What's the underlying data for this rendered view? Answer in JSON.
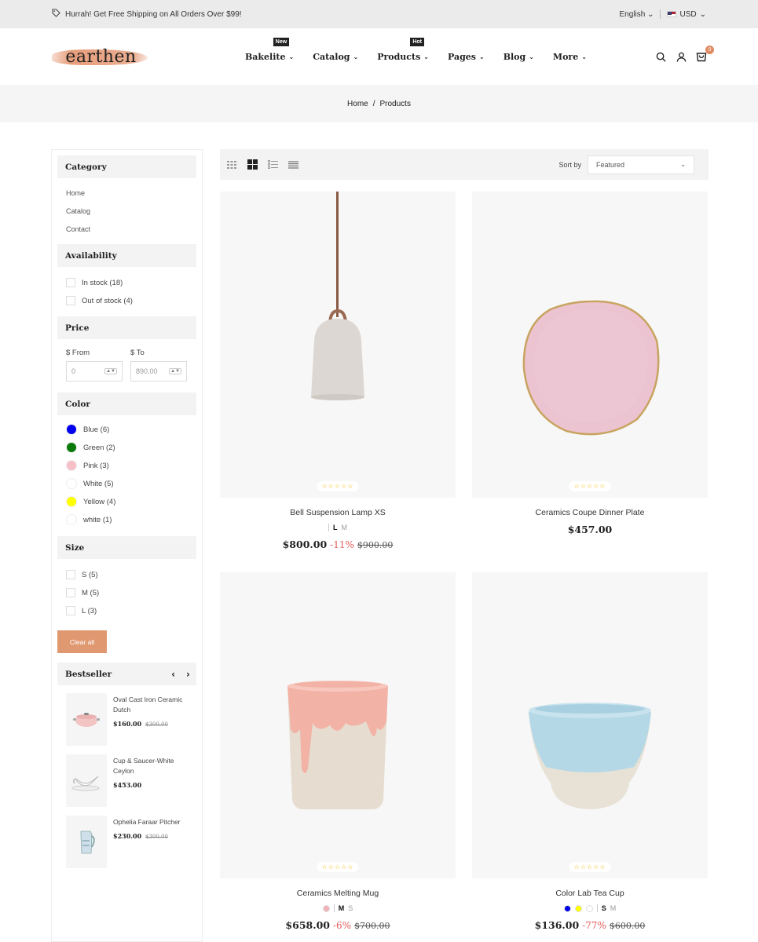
{
  "topbar": {
    "promo": "Hurrah! Get Free Shipping on All Orders Over $99!",
    "language": "English",
    "currency": "USD"
  },
  "header": {
    "logo": "earthen",
    "nav": [
      {
        "label": "Bakelite",
        "badge": "New"
      },
      {
        "label": "Catalog",
        "badge": ""
      },
      {
        "label": "Products",
        "badge": "Hot"
      },
      {
        "label": "Pages",
        "badge": ""
      },
      {
        "label": "Blog",
        "badge": ""
      },
      {
        "label": "More",
        "badge": ""
      }
    ],
    "cart_count": "0"
  },
  "breadcrumb": {
    "home": "Home",
    "separator": "/",
    "current": "Products"
  },
  "sidebar": {
    "category": {
      "title": "Category",
      "links": [
        "Home",
        "Catalog",
        "Contact"
      ]
    },
    "availability": {
      "title": "Availability",
      "options": [
        "In stock (18)",
        "Out of stock (4)"
      ]
    },
    "price": {
      "title": "Price",
      "from_label": "$ From",
      "to_label": "$ To",
      "from_placeholder": "0",
      "to_placeholder": "890.00"
    },
    "color": {
      "title": "Color",
      "options": [
        {
          "label": "Blue (6)",
          "swatch": "#0000ee"
        },
        {
          "label": "Green (2)",
          "swatch": "#0a7a0a"
        },
        {
          "label": "Pink (3)",
          "swatch": "#f7bfc8"
        },
        {
          "label": "White (5)",
          "swatch": "#ffffff"
        },
        {
          "label": "Yellow (4)",
          "swatch": "#ffff00"
        },
        {
          "label": "white (1)",
          "swatch": "#ffffff"
        }
      ]
    },
    "size": {
      "title": "Size",
      "options": [
        "S (5)",
        "M (5)",
        "L (3)"
      ]
    },
    "clear_label": "Clear all",
    "bestseller": {
      "title": "Bestseller",
      "items": [
        {
          "name": "Oval Cast Iron Ceramic Dutch",
          "price": "$160.00",
          "old_price": "$300.00"
        },
        {
          "name": "Cup & Saucer-White Ceylon",
          "price": "$453.00",
          "old_price": ""
        },
        {
          "name": "Ophelia Faraar Pitcher",
          "price": "$230.00",
          "old_price": "$300.00"
        }
      ]
    }
  },
  "toolbar": {
    "sort_label": "Sort by",
    "sort_value": "Featured"
  },
  "products": [
    {
      "title": "Bell Suspension Lamp XS",
      "variants": [
        "L",
        "M"
      ],
      "selected": "L",
      "price": "$800.00",
      "discount": "-11%",
      "old_price": "$900.00",
      "icon": "pendant-lamp-icon"
    },
    {
      "title": "Ceramics Coupe Dinner Plate",
      "variants": [],
      "selected": "",
      "price": "$457.00",
      "discount": "",
      "old_price": "",
      "icon": "plate-icon"
    },
    {
      "title": "Ceramics Melting Mug",
      "variants": [
        "M",
        "S"
      ],
      "selected": "M",
      "price": "$658.00",
      "discount": "-6%",
      "old_price": "$700.00",
      "icon": "mug-icon"
    },
    {
      "title": "Color Lab Tea Cup",
      "variants": [
        "S",
        "M"
      ],
      "selected": "S",
      "price": "$136.00",
      "discount": "-77%",
      "old_price": "$600.00",
      "icon": "tea-cup-icon"
    }
  ],
  "colors": {
    "accent": "#e09870",
    "discount": "#e35b5b",
    "star": "#f0b400"
  }
}
